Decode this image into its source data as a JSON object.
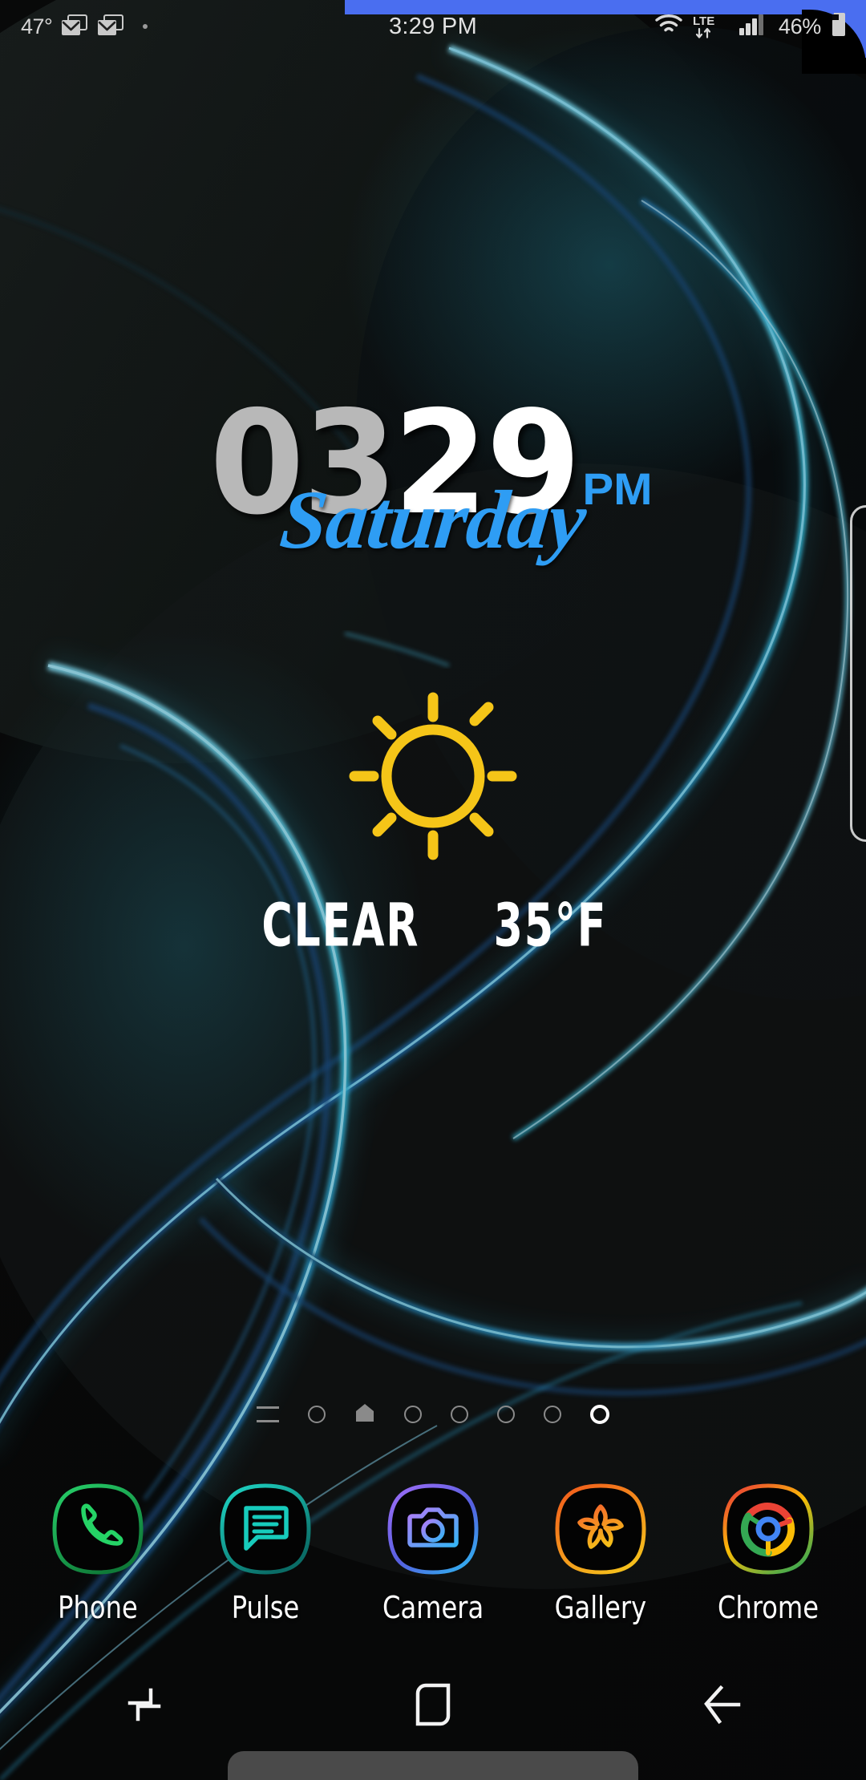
{
  "status_bar": {
    "temperature": "47°",
    "notification_icons": [
      "mail-icon",
      "mail-icon",
      "dot-icon"
    ],
    "clock": "3:29 PM",
    "network_type": "LTE",
    "battery_percent": "46%",
    "icons_right": [
      "wifi-icon",
      "lte-icon",
      "signal-icon",
      "battery-icon"
    ]
  },
  "clock_widget": {
    "hour": "03",
    "minute": "29",
    "meridiem": "PM",
    "weekday": "Saturday",
    "hour_color": "#b8b8b8",
    "minute_color": "#ffffff",
    "accent_color": "#2e9df4"
  },
  "weather_widget": {
    "icon": "sun-icon",
    "icon_color": "#f5c518",
    "condition": "CLEAR",
    "temperature": "35°F"
  },
  "page_indicator": {
    "items": [
      {
        "type": "lines",
        "active": false
      },
      {
        "type": "circle",
        "active": false
      },
      {
        "type": "home",
        "active": false
      },
      {
        "type": "circle",
        "active": false
      },
      {
        "type": "circle",
        "active": false
      },
      {
        "type": "circle",
        "active": false
      },
      {
        "type": "circle",
        "active": false
      },
      {
        "type": "circle",
        "active": true
      }
    ],
    "current_page": 8,
    "total_pages": 8
  },
  "dock": {
    "apps": [
      {
        "label": "Phone",
        "icon": "phone-icon",
        "color": "#1ec95a",
        "ring_from": "#1a8f3e",
        "ring_to": "#25d366"
      },
      {
        "label": "Pulse",
        "icon": "message-icon",
        "color": "#14c7b8",
        "ring_from": "#0c7a72",
        "ring_to": "#1fd7c6"
      },
      {
        "label": "Camera",
        "icon": "camera-icon",
        "color": "#9a7cf0",
        "ring_from": "#8a5cf0",
        "ring_to": "#2aa8f0"
      },
      {
        "label": "Gallery",
        "icon": "flower-icon",
        "color": "#f58a2a",
        "ring_from": "#e8601c",
        "ring_to": "#f5bb1c"
      },
      {
        "label": "Chrome",
        "icon": "chrome-icon",
        "color": "#4285f4",
        "ring_from": "#ea4335",
        "ring_to": "#34a853"
      }
    ]
  },
  "nav_bar": {
    "buttons": [
      {
        "name": "recents",
        "icon": "recents-icon"
      },
      {
        "name": "home",
        "icon": "home-square-icon"
      },
      {
        "name": "back",
        "icon": "back-arrow-icon"
      }
    ]
  },
  "edge_panel": {
    "handle": "edge-panel-handle"
  },
  "theme": {
    "background": "#070707",
    "accent_blue": "#2e9df4",
    "top_accent": "#4a6ef0",
    "glow_cyan": "#35c8e8"
  }
}
